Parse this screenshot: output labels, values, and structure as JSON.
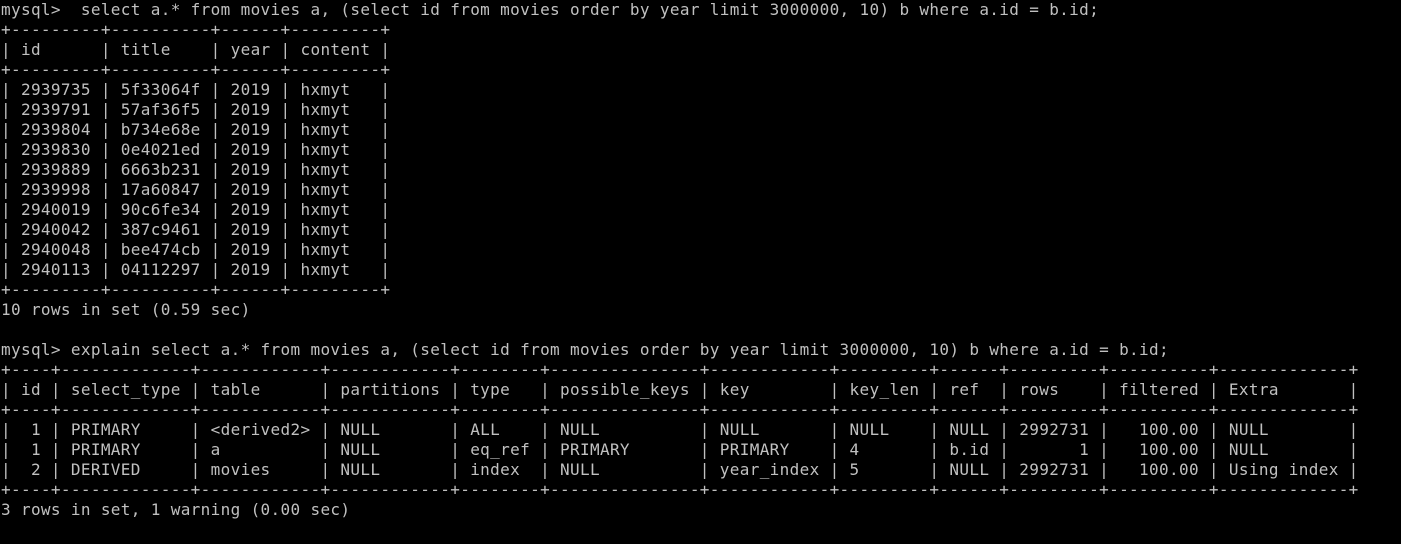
{
  "terminal": {
    "background": "#000000",
    "foreground": "#c0c0c0",
    "lines": [
      {
        "kind": "command",
        "text": "mysql>  select a.* from movies a, (select id from movies order by year limit 3000000, 10) b where a.id = b.id;"
      },
      {
        "kind": "border",
        "text": "+---------+----------+------+---------+"
      },
      {
        "kind": "row",
        "text": "| id      | title    | year | content |"
      },
      {
        "kind": "border",
        "text": "+---------+----------+------+---------+"
      },
      {
        "kind": "row",
        "text": "| 2939735 | 5f33064f | 2019 | hxmyt   |"
      },
      {
        "kind": "row",
        "text": "| 2939791 | 57af36f5 | 2019 | hxmyt   |"
      },
      {
        "kind": "row",
        "text": "| 2939804 | b734e68e | 2019 | hxmyt   |"
      },
      {
        "kind": "row",
        "text": "| 2939830 | 0e4021ed | 2019 | hxmyt   |"
      },
      {
        "kind": "row",
        "text": "| 2939889 | 6663b231 | 2019 | hxmyt   |"
      },
      {
        "kind": "row",
        "text": "| 2939998 | 17a60847 | 2019 | hxmyt   |"
      },
      {
        "kind": "row",
        "text": "| 2940019 | 90c6fe34 | 2019 | hxmyt   |"
      },
      {
        "kind": "row",
        "text": "| 2940042 | 387c9461 | 2019 | hxmyt   |"
      },
      {
        "kind": "row",
        "text": "| 2940048 | bee474cb | 2019 | hxmyt   |"
      },
      {
        "kind": "row",
        "text": "| 2940113 | 04112297 | 2019 | hxmyt   |"
      },
      {
        "kind": "border",
        "text": "+---------+----------+------+---------+"
      },
      {
        "kind": "status",
        "text": "10 rows in set (0.59 sec)"
      },
      {
        "kind": "blank",
        "text": ""
      },
      {
        "kind": "command",
        "text": "mysql> explain select a.* from movies a, (select id from movies order by year limit 3000000, 10) b where a.id = b.id;"
      },
      {
        "kind": "border",
        "text": "+----+-------------+------------+------------+--------+---------------+------------+---------+------+---------+----------+-------------+"
      },
      {
        "kind": "row",
        "text": "| id | select_type | table      | partitions | type   | possible_keys | key        | key_len | ref  | rows    | filtered | Extra       |"
      },
      {
        "kind": "border",
        "text": "+----+-------------+------------+------------+--------+---------------+------------+---------+------+---------+----------+-------------+"
      },
      {
        "kind": "row",
        "text": "|  1 | PRIMARY     | <derived2> | NULL       | ALL    | NULL          | NULL       | NULL    | NULL | 2992731 |   100.00 | NULL        |"
      },
      {
        "kind": "row",
        "text": "|  1 | PRIMARY     | a          | NULL       | eq_ref | PRIMARY       | PRIMARY    | 4       | b.id |       1 |   100.00 | NULL        |"
      },
      {
        "kind": "row",
        "text": "|  2 | DERIVED     | movies     | NULL       | index  | NULL          | year_index | 5       | NULL | 2992731 |   100.00 | Using index |"
      },
      {
        "kind": "border",
        "text": "+----+-------------+------------+------------+--------+---------------+------------+---------+------+---------+----------+-------------+"
      },
      {
        "kind": "status",
        "text": "3 rows in set, 1 warning (0.00 sec)"
      }
    ]
  }
}
